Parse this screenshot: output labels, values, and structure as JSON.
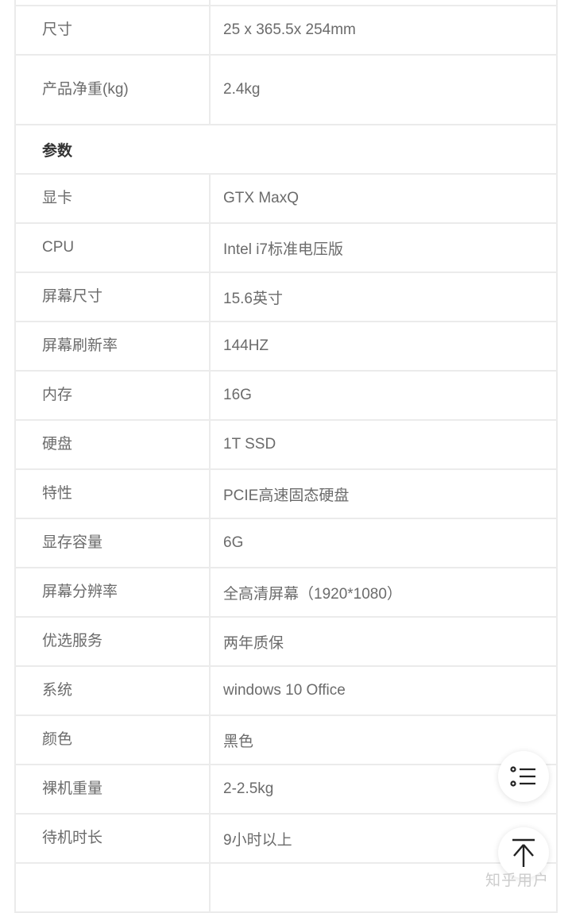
{
  "rows": [
    {
      "k": "",
      "v": ""
    },
    {
      "k": "尺寸",
      "v": "25 x 365.5x 254mm"
    },
    {
      "k": "产品净重(kg)",
      "v": "2.4kg"
    },
    {
      "header": "参数"
    },
    {
      "k": "显卡",
      "v": "GTX MaxQ"
    },
    {
      "k": "CPU",
      "v": "Intel i7标准电压版"
    },
    {
      "k": "屏幕尺寸",
      "v": "15.6英寸"
    },
    {
      "k": "屏幕刷新率",
      "v": "144HZ"
    },
    {
      "k": "内存",
      "v": "16G"
    },
    {
      "k": "硬盘",
      "v": "1T SSD"
    },
    {
      "k": "特性",
      "v": "PCIE高速固态硬盘"
    },
    {
      "k": "显存容量",
      "v": "6G"
    },
    {
      "k": "屏幕分辨率",
      "v": "全高清屏幕（1920*1080）"
    },
    {
      "k": "优选服务",
      "v": "两年质保"
    },
    {
      "k": "系统",
      "v": "windows 10 Office"
    },
    {
      "k": "颜色",
      "v": "黑色"
    },
    {
      "k": "裸机重量",
      "v": "2-2.5kg"
    },
    {
      "k": "待机时长",
      "v": "9小时以上"
    },
    {
      "k": "",
      "v": ""
    }
  ],
  "watermark": "知乎用户",
  "icons": {
    "toc": "list-icon",
    "top": "back-to-top-icon"
  }
}
